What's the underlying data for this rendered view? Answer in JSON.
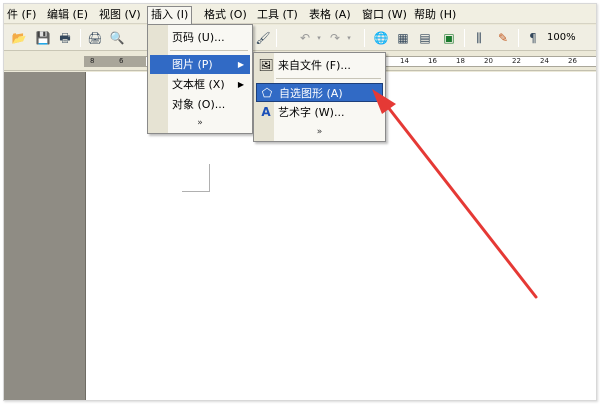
{
  "menubar": {
    "items": [
      "件 (F)",
      "编辑 (E)",
      "视图 (V)",
      "插入 (I)",
      "格式 (O)",
      "工具 (T)",
      "表格 (A)",
      "窗口 (W)",
      "帮助 (H)"
    ]
  },
  "insert_menu": {
    "items": [
      "页码 (U)...",
      "图片 (P)",
      "文本框 (X)",
      "对象 (O)..."
    ],
    "more": "»"
  },
  "picture_submenu": {
    "items": [
      "来自文件 (F)...",
      "自选图形 (A)",
      "艺术字 (W)..."
    ],
    "more": "»"
  },
  "toolbar": {
    "zoom": "100%",
    "icons": [
      "open-icon",
      "save-icon",
      "permission-icon",
      "print-icon",
      "print-preview-icon",
      "spelling-icon",
      "format-painter-icon",
      "undo-icon",
      "redo-icon",
      "hyperlink-icon",
      "tables-borders-icon",
      "insert-table-icon",
      "insert-excel-icon",
      "columns-icon",
      "drawing-icon",
      "show-hide-icon"
    ]
  },
  "ruler": {
    "ticks": [
      "8",
      "6",
      "14",
      "16",
      "18",
      "20",
      "22",
      "24",
      "26"
    ]
  },
  "colors": {
    "highlight": "#316ac5",
    "arrow": "#e53935",
    "menu_background": "#f9f8f3"
  }
}
